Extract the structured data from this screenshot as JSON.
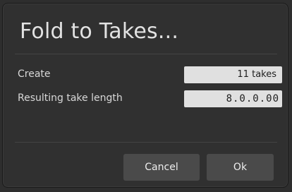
{
  "dialog": {
    "title": "Fold to Takes..."
  },
  "fields": [
    {
      "label": "Create",
      "value": "11 takes"
    },
    {
      "label": "Resulting take length",
      "value": "8.0.0.00"
    }
  ],
  "buttons": {
    "cancel_label": "Cancel",
    "ok_label": "Ok"
  }
}
